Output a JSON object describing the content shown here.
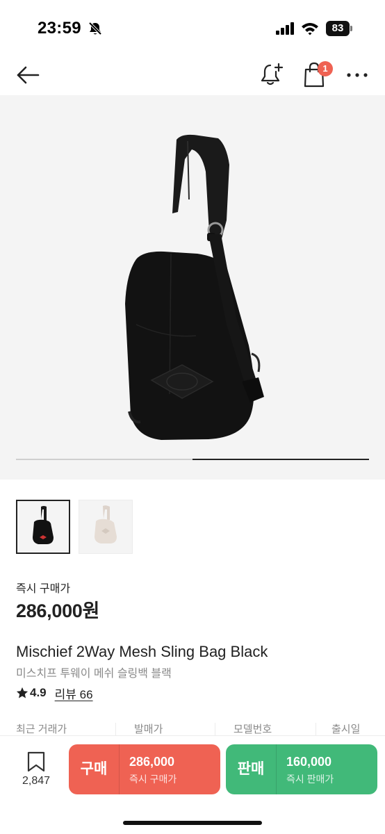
{
  "status_bar": {
    "time": "23:59",
    "battery": "83",
    "icons": [
      "bell-slash-icon",
      "cellular-signal-icon",
      "wifi-icon",
      "battery-icon"
    ]
  },
  "nav": {
    "icons": [
      "back-arrow-icon",
      "bell-plus-icon",
      "shopping-bag-icon",
      "more-icon"
    ],
    "cart_badge": "1"
  },
  "gallery": {
    "current_page": 2,
    "total_pages": 2,
    "thumbnails": [
      {
        "color": "black",
        "selected": true
      },
      {
        "color": "beige",
        "selected": false
      }
    ]
  },
  "price": {
    "label": "즉시 구매가",
    "value": "286,000원"
  },
  "product": {
    "name": "Mischief 2Way Mesh Sling Bag Black",
    "name_ko": "미스치프 투웨이 메쉬 슬링백 블랙",
    "rating": "4.9",
    "review_label": "리뷰 66"
  },
  "info_row": {
    "columns": [
      "최근 거래가",
      "발매가",
      "모델번호",
      "출시일"
    ]
  },
  "bottom_bar": {
    "wish_count": "2,847",
    "buy": {
      "label": "구매",
      "price": "286,000",
      "sub": "즉시 구매가"
    },
    "sell": {
      "label": "판매",
      "price": "160,000",
      "sub": "즉시 판매가"
    }
  },
  "colors": {
    "buy": "#ef6253",
    "sell": "#41b979",
    "badge": "#ef6253",
    "hero_bg": "#f4f4f4"
  }
}
